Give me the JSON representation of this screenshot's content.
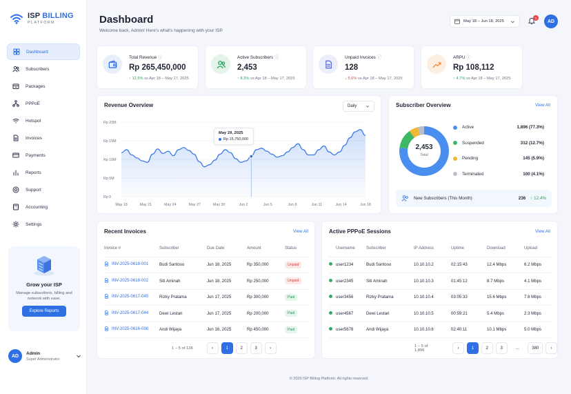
{
  "brand": {
    "name_part1": "ISP",
    "name_part2": "BILLING",
    "subtitle": "PLATFORM"
  },
  "sidebar": {
    "items": [
      {
        "label": "Dashboard",
        "icon": "grid-icon",
        "active": true
      },
      {
        "label": "Subscribers",
        "icon": "users-icon"
      },
      {
        "label": "Packages",
        "icon": "package-icon"
      },
      {
        "label": "PPPoE",
        "icon": "network-icon"
      },
      {
        "label": "Hotspot",
        "icon": "wifi-icon"
      },
      {
        "label": "Invoices",
        "icon": "document-icon"
      },
      {
        "label": "Payments",
        "icon": "credit-card-icon"
      },
      {
        "label": "Reports",
        "icon": "bar-chart-icon"
      },
      {
        "label": "Support",
        "icon": "lifebuoy-icon"
      },
      {
        "label": "Accounting",
        "icon": "calculator-icon"
      },
      {
        "label": "Settings",
        "icon": "gear-icon"
      }
    ],
    "promo": {
      "title": "Grow your ISP",
      "text": "Manage subscribers, billing and network with ease.",
      "button": "Explore Reports"
    },
    "user": {
      "initials": "AD",
      "name": "Admin",
      "role": "Super Administrator"
    }
  },
  "header": {
    "title": "Dashboard",
    "subtitle": "Welcome back, Admin! Here's what's happening with your ISP.",
    "date_range": "May 18 – Jun 18, 2025",
    "notifications": "3",
    "avatar": "AD"
  },
  "kpis": [
    {
      "label": "Total Revenue",
      "value": "Rp 265,450,000",
      "change": "12.5%",
      "trend": "up",
      "compare": "vs Apr 18 – May 17, 2025",
      "color": "#2f6fe4",
      "bg": "#e8effc",
      "icon": "wallet-icon"
    },
    {
      "label": "Active Subscribers",
      "value": "2,453",
      "change": "8.3%",
      "trend": "up",
      "compare": "vs Apr 18 – May 17, 2025",
      "color": "#27a35a",
      "bg": "#e3f5ea",
      "icon": "users-icon"
    },
    {
      "label": "Unpaid Invoices",
      "value": "128",
      "change": "5.6%",
      "trend": "down",
      "compare": "vs Apr 18 – May 17, 2025",
      "color": "#5b6ee1",
      "bg": "#eceefc",
      "icon": "document-icon"
    },
    {
      "label": "ARPU",
      "value": "Rp 108,112",
      "change": "4.7%",
      "trend": "up",
      "compare": "vs Apr 18 – May 17, 2025",
      "color": "#f08a3c",
      "bg": "#fdeee2",
      "icon": "trend-up-icon"
    }
  ],
  "revenue": {
    "title": "Revenue Overview",
    "period": "Daily",
    "tooltip": {
      "date": "May 29, 2025",
      "value": "Rp 15,750,000"
    }
  },
  "chart_data": {
    "type": "area",
    "y_ticks": [
      "Rp 0",
      "Rp 5M",
      "Rp 10M",
      "Rp 15M",
      "Rp 20M"
    ],
    "ylim": [
      0,
      20
    ],
    "x_ticks": [
      "May 18",
      "May 21",
      "May 24",
      "May 27",
      "May 30",
      "Jun 2",
      "Jun 5",
      "Jun 8",
      "Jun 11",
      "Jun 14",
      "Jun 18"
    ],
    "series": [
      {
        "values": [
          11.8,
          12.6,
          11.2,
          10.4,
          9.6,
          9.2,
          11.4,
          12.8,
          11.6,
          12.2,
          11.0,
          12.6,
          13.2,
          12.4,
          11.4,
          9.4,
          8.0,
          8.6,
          9.8,
          11.4,
          12.6,
          11.8,
          10.2,
          9.2,
          9.6,
          10.8,
          12.6,
          13.0,
          12.2,
          11.4,
          10.6,
          11.0,
          12.0,
          13.2,
          14.2,
          12.6,
          11.2,
          11.2,
          12.6,
          13.6,
          12.0,
          11.2,
          12.0,
          13.8,
          15.8,
          17.4,
          18.0,
          16.4
        ]
      }
    ],
    "highlight_index": 25
  },
  "subscriber_overview": {
    "title": "Subscriber Overview",
    "link": "View All",
    "total": "2,453",
    "total_label": "Total",
    "segments": [
      {
        "label": "Active",
        "value": 1896,
        "display": "1,896 (77.3%)",
        "color": "#4a8ff0"
      },
      {
        "label": "Suspended",
        "value": 312,
        "display": "312 (12.7%)",
        "color": "#3fb865"
      },
      {
        "label": "Pending",
        "value": 145,
        "display": "145 (5.9%)",
        "color": "#f2b733"
      },
      {
        "label": "Terminated",
        "value": 100,
        "display": "100 (4.1%)",
        "color": "#b9bec9"
      }
    ],
    "new_subs": {
      "label": "New Subscribers (This Month)",
      "value": "236",
      "change": "12.4%"
    }
  },
  "invoices": {
    "title": "Recent Invoices",
    "link": "View All",
    "headers": [
      "Invoice #",
      "Subscriber",
      "Due Date",
      "Amount",
      "Status"
    ],
    "rows": [
      [
        "INV-2025-0618-001",
        "Budi Santoso",
        "Jun 18, 2025",
        "Rp 350,000",
        "Unpaid"
      ],
      [
        "INV-2025-0618-002",
        "Siti Aminah",
        "Jun 18, 2025",
        "Rp 250,000",
        "Unpaid"
      ],
      [
        "INV-2025-0617-045",
        "Rizky Pratama",
        "Jun 17, 2025",
        "Rp 300,000",
        "Paid"
      ],
      [
        "INV-2025-0617-044",
        "Dewi Lestari",
        "Jun 17, 2025",
        "Rp 200,000",
        "Paid"
      ],
      [
        "INV-2025-0616-098",
        "Andi Wijaya",
        "Jun 16, 2025",
        "Rp 450,000",
        "Paid"
      ]
    ],
    "pager_info": "1 – 5 of 128",
    "pages": [
      "‹",
      "1",
      "2",
      "3",
      "›"
    ]
  },
  "sessions": {
    "title": "Active PPPoE Sessions",
    "link": "View All",
    "headers": [
      "Username",
      "Subscriber",
      "IP Address",
      "Uptime",
      "Download",
      "Upload"
    ],
    "rows": [
      [
        "user1234",
        "Budi Santoso",
        "10.10.10.2",
        "02:15:43",
        "12.4 Mbps",
        "6.2 Mbps"
      ],
      [
        "user2345",
        "Siti Aminah",
        "10.10.10.3",
        "01:45:12",
        "8.7 Mbps",
        "4.1 Mbps"
      ],
      [
        "user3456",
        "Rizky Pratama",
        "10.10.10.4",
        "03:05:33",
        "15.6 Mbps",
        "7.8 Mbps"
      ],
      [
        "user4567",
        "Dewi Lestari",
        "10.10.10.5",
        "00:59:21",
        "5.4 Mbps",
        "2.3 Mbps"
      ],
      [
        "user5678",
        "Andi Wijaya",
        "10.10.10.6",
        "02:40:11",
        "10.1 Mbps",
        "5.0 Mbps"
      ]
    ],
    "pager_info": "1 – 5 of 1,896",
    "pages": [
      "‹",
      "1",
      "2",
      "3",
      "...",
      "380",
      "›"
    ]
  },
  "footer": "© 2025 ISP Billing Platform. All rights reserved."
}
